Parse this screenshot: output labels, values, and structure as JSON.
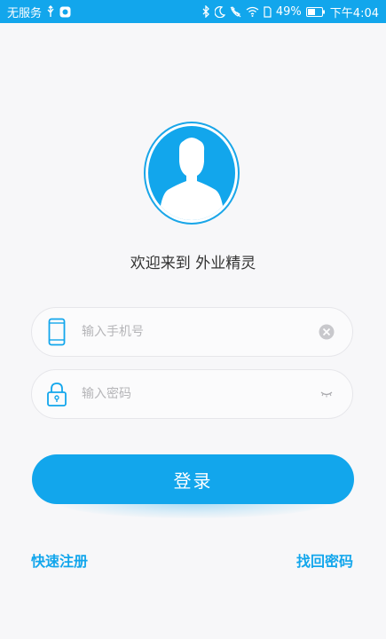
{
  "status_bar": {
    "carrier": "无服务",
    "battery": "49%",
    "time": "下午4:04",
    "icons_left": [
      "usb-icon",
      "app-notification-icon"
    ],
    "icons_right": [
      "bluetooth-icon",
      "moon-icon",
      "mute-icon",
      "wifi-icon",
      "sim-icon",
      "battery-icon"
    ]
  },
  "welcome_text": "欢迎来到 外业精灵",
  "phone_field": {
    "placeholder": "输入手机号",
    "value": "",
    "leading_icon": "phone-icon",
    "trailing_icon": "clear-icon"
  },
  "password_field": {
    "placeholder": "输入密码",
    "value": "",
    "leading_icon": "lock-icon",
    "trailing_icon": "eye-closed-icon"
  },
  "login_button": {
    "label": "登录"
  },
  "links": {
    "register": "快速注册",
    "forgot": "找回密码"
  },
  "colors": {
    "accent": "#12a6ec",
    "background": "#f7f7f9",
    "text": "#333333",
    "placeholder": "#b5b5b8"
  }
}
